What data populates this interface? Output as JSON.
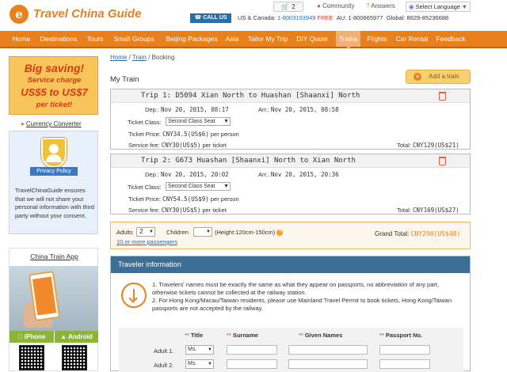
{
  "header": {
    "logo_letter": "e",
    "logo_text": "Travel China Guide",
    "cart_count": "2",
    "community": "Community",
    "answers": "Answers",
    "language": "Select Language",
    "call_us": "CALL US",
    "contact_us_label": "US & Canada:",
    "contact_us_phone": "1-8003153949",
    "contact_free": "FREE",
    "contact_au": "AU: 1-800665977",
    "contact_global": "Global: 8629-85236688"
  },
  "nav": {
    "items": [
      "Home",
      "Destinations",
      "Tours",
      "Small Groups",
      "Beijing Packages",
      "Asia",
      "Tailor My Trip",
      "DIY Quote",
      "Trains",
      "Flights",
      "Car Rental",
      "Feedback"
    ],
    "active": "Trains"
  },
  "sidebar": {
    "promo_l1": "Big saving!",
    "promo_l2": "Service charge",
    "promo_l3": "US$5 to US$7",
    "promo_l4": "per ticket!",
    "currency": "Currency Converter",
    "privacy_ribbon": "Privacy Policy",
    "privacy_text": "TravelChinaGuide ensures that we will not share your personal information with third party without your consent.",
    "app_title": "China Train App",
    "iphone": "iPhone",
    "android": "Android"
  },
  "breadcrumb": {
    "home": "Home",
    "train": "Train",
    "current": "Booking",
    "sep": "/"
  },
  "main": {
    "heading": "My Train",
    "add_train": "Add a train"
  },
  "trips": [
    {
      "title": "Trip 1: D5094 Xian North to Huashan [Shaanxi] North",
      "dep_label": "Dep.:",
      "dep": "Nov 20, 2015, 08:17",
      "arr_label": "Arr.:",
      "arr": "Nov 20, 2015, 08:58",
      "class_label": "Ticket Class:",
      "class_value": "Second Class Seat",
      "price_label": "Ticket Price:",
      "price": "CNY34.5(US$6)",
      "per_person": "per person",
      "fee_label": "Service fee:",
      "fee": "CNY30(US$5)",
      "per_ticket": "per ticket",
      "total_label": "Total:",
      "total": "CNY129(US$21)"
    },
    {
      "title": "Trip 2: G673 Huashan [Shaanxi] North to Xian North",
      "dep_label": "Dep.:",
      "dep": "Nov 20, 2015, 20:02",
      "arr_label": "Arr.:",
      "arr": "Nov 20, 2015, 20:36",
      "class_label": "Ticket Class:",
      "class_value": "Second Class Seat",
      "price_label": "Ticket Price:",
      "price": "CNY54.5(US$9)",
      "per_person": "per person",
      "fee_label": "Service fee:",
      "fee": "CNY30(US$5)",
      "per_ticket": "per ticket",
      "total_label": "Total:",
      "total": "CNY169(US$27)"
    }
  ],
  "passengers": {
    "adults_label": "Adults",
    "adults_value": "2",
    "children_label": "Children",
    "children_value": "",
    "height_note": "(Height:120cm-150cm)",
    "more_link": "10 or more passengers",
    "grand_total_label": "Grand Total:",
    "grand_total": "CNY298(US$48)"
  },
  "traveler": {
    "heading": "Traveler information",
    "note1": "1. Travelers' names must be exactly the same as what they appear on passports, no abbreviation of any part, otherwise tickets cannot be collected at the railway station.",
    "note2": "2. For Hong Kong/Macau/Taiwan residents, please use Mainland Travel Permit to book tickets, Hong Kong/Taiwan passports are not accepted by the railway.",
    "col_title": "Title",
    "col_surname": "Surname",
    "col_given": "Given Names",
    "col_passport": "Passport No.",
    "star": "**",
    "rows": [
      {
        "label": "Adult 1.",
        "title": "Ms."
      },
      {
        "label": "Adult 2.",
        "title": "Ms."
      }
    ]
  },
  "colors": {
    "brand_orange": "#e8801c",
    "nav_active": "#f3b074",
    "link_blue": "#2a6ea8",
    "traveler_header": "#3d6f94",
    "grand_total": "#e8801c"
  }
}
